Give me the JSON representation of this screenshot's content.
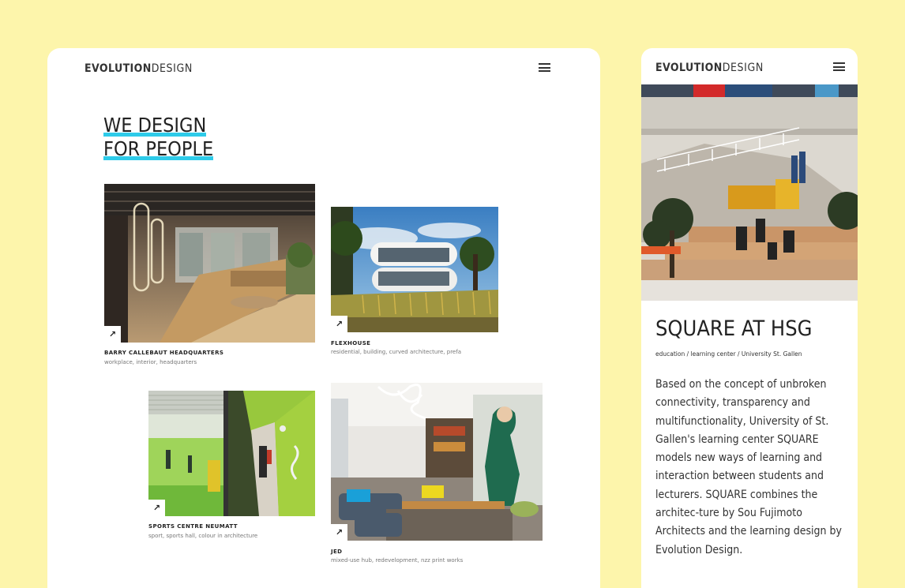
{
  "brand": {
    "logo_bold": "EVOLUTION",
    "logo_light": "DESIGN"
  },
  "desktop": {
    "hero_line1": "WE DESIGN",
    "hero_line2": "FOR PEOPLE",
    "projects": [
      {
        "name": "BARRY CALLEBAUT HEADQUARTERS",
        "tags": "workplace, interior, headquarters"
      },
      {
        "name": "FLEXHOUSE",
        "tags": "residential, building, curved architecture, prefa"
      },
      {
        "name": "SPORTS CENTRE NEUMATT",
        "tags": "sport, sports hall, colour in architecture"
      },
      {
        "name": "JED",
        "tags": "mixed-use hub, redevelopment, nzz print works"
      }
    ],
    "arrow_glyph": "↗"
  },
  "mobile": {
    "title": "SQUARE AT HSG",
    "tags": "education / learning center / University St. Gallen",
    "body": "Based on the concept of unbroken connectivity, transparency and multifunctionality, University of St. Gallen's learning center SQUARE models new ways of learning and interaction between students and lecturers. SQUARE combines the architec-ture by Sou Fujimoto Architects and the learning design by Evolution Design."
  },
  "colors": {
    "background": "#fdf5ab",
    "accent_underline": "#2ecbe9",
    "text": "#222222"
  },
  "icons": [
    "menu-icon",
    "arrow-up-right-icon"
  ]
}
